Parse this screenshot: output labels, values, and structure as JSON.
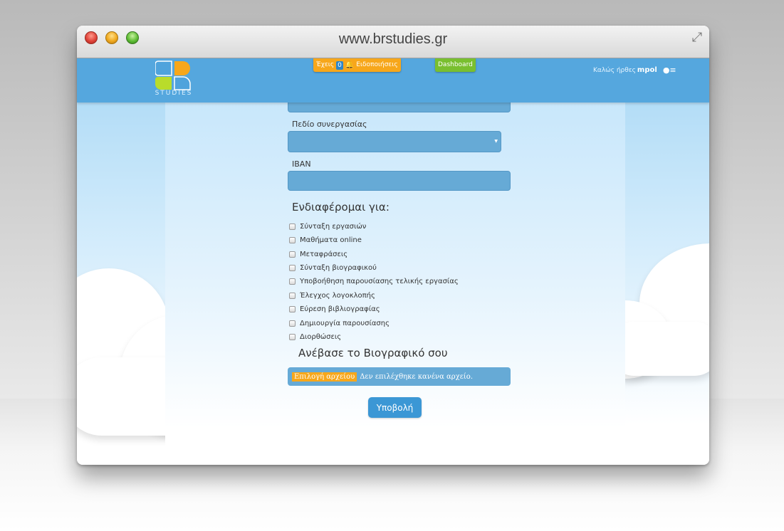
{
  "browser": {
    "url": "www.brstudies.gr"
  },
  "navbar": {
    "logo_text": "STUDIES",
    "notifications": {
      "prefix": "Έχεις",
      "count": "0",
      "suffix": "Ειδοποιήσεις"
    },
    "dashboard_label": "Dashboard",
    "welcome_text": "Καλώς ήρθες",
    "username": "mpol"
  },
  "form": {
    "field_cooperation_label": "Πεδίο συνεργασίας",
    "iban_label": "IBAN",
    "interest_heading": "Ενδιαφέρομαι για:",
    "interests": [
      "Σύνταξη εργασιών",
      "Μαθήματα online",
      "Μεταφράσεις",
      "Σύνταξη βιογραφικού",
      "Υποβοήθηση παρουσίασης τελικής εργασίας",
      "Έλεγχος λογοκλοπής",
      "Εύρεση βιβλιογραφίας",
      "Δημιουργία παρουσίασης",
      "Διορθώσεις"
    ],
    "upload_heading": "Ανέβασε το Βιογραφικό σου",
    "file_button": "Επιλογή αρχείου",
    "file_status": "Δεν επιλέχθηκε κανένα αρχείο.",
    "submit_label": "Υποβολή"
  },
  "colors": {
    "navbar": "#55a7de",
    "accent_orange": "#f7a71b",
    "accent_green": "#79bf2f",
    "input_blue": "#66aad6"
  }
}
